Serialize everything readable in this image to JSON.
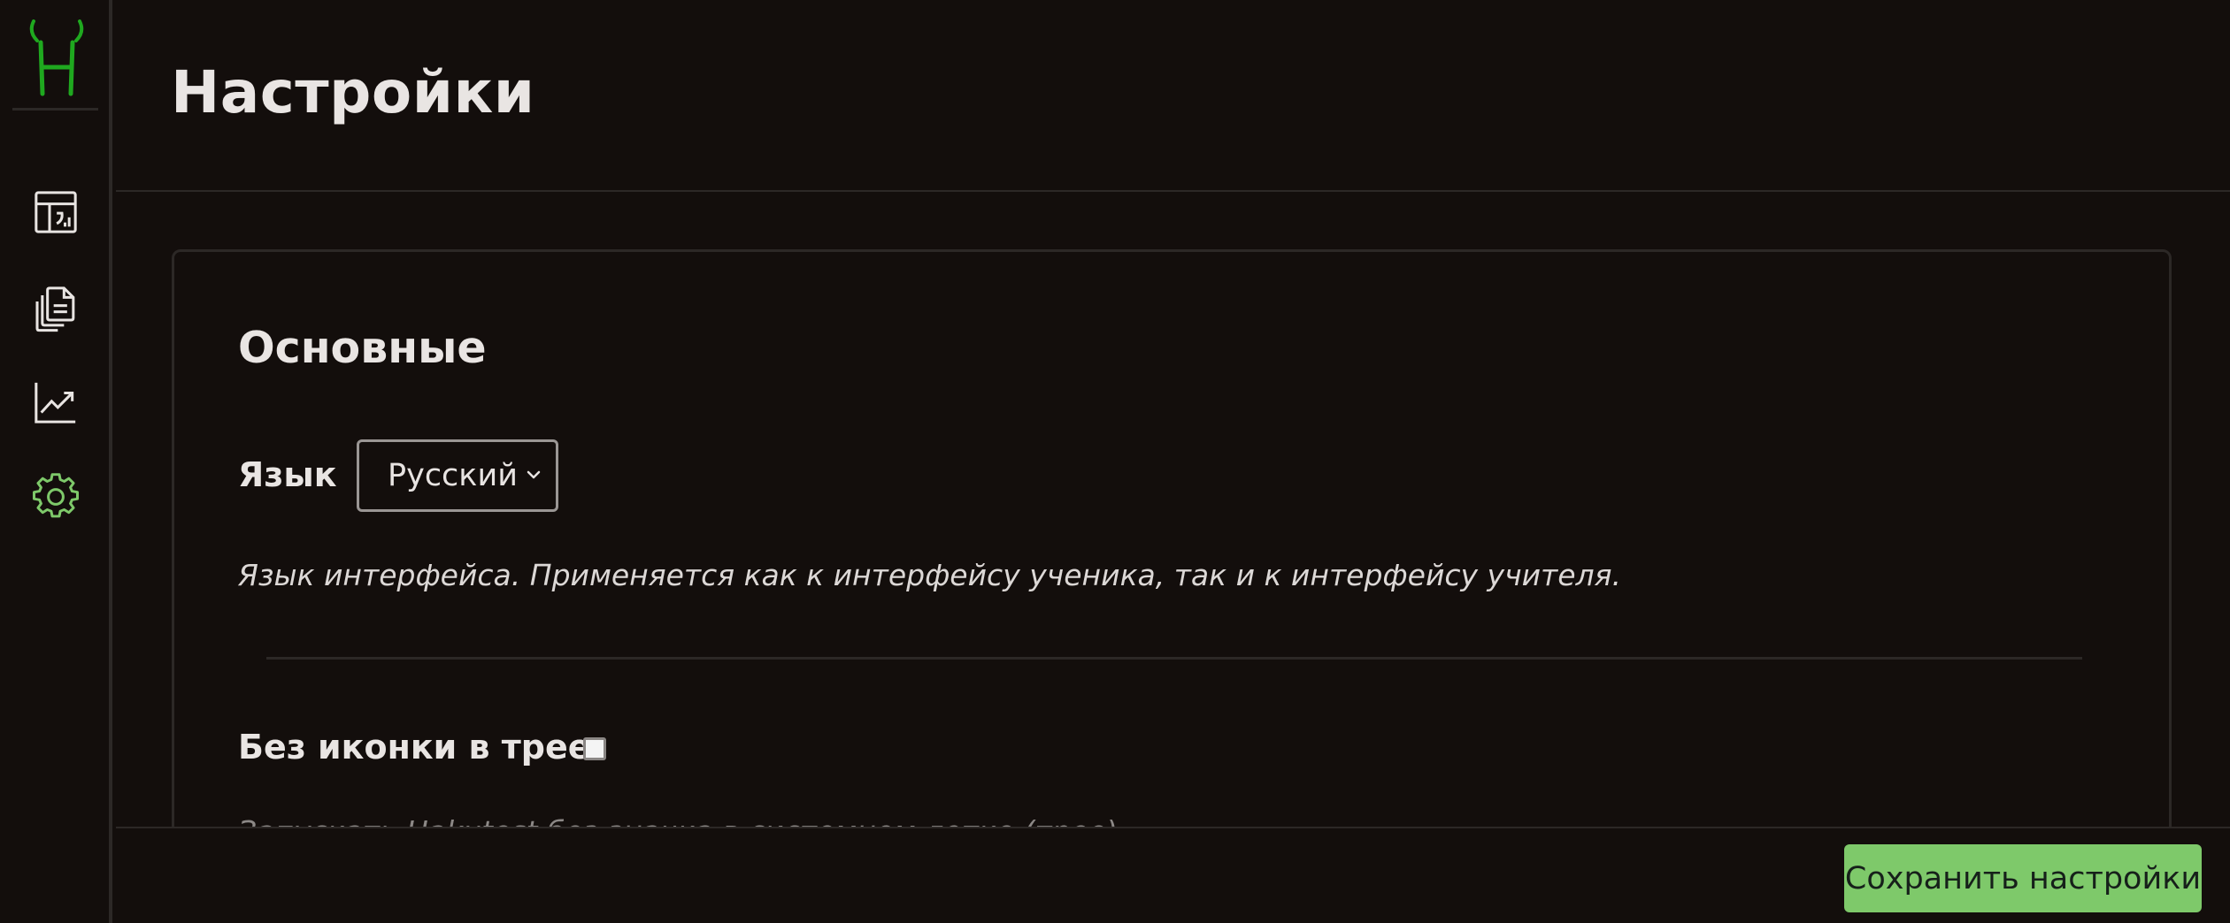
{
  "header": {
    "title": "Настройки"
  },
  "sidebar": {
    "items": [
      {
        "name": "dashboard",
        "icon": "dashboard-icon"
      },
      {
        "name": "documents",
        "icon": "documents-icon"
      },
      {
        "name": "statistics",
        "icon": "chart-line-icon"
      },
      {
        "name": "settings",
        "icon": "gear-icon",
        "active": true
      }
    ]
  },
  "settings": {
    "section_title": "Основные",
    "language": {
      "label": "Язык",
      "value": "Русский",
      "description": "Язык интерфейса. Применяется как к интерфейсу ученика, так и к интерфейсу учителя."
    },
    "tray": {
      "label": "Без иконки в трее",
      "checked": false,
      "description": "Запускать Hakutest без значка в системном лотке (трее)."
    }
  },
  "footer": {
    "save_label": "Сохранить настройки"
  },
  "colors": {
    "background": "#130e0c",
    "accent": "#7ec96a",
    "logo_green": "#1fa81f",
    "border": "#2c2826"
  }
}
